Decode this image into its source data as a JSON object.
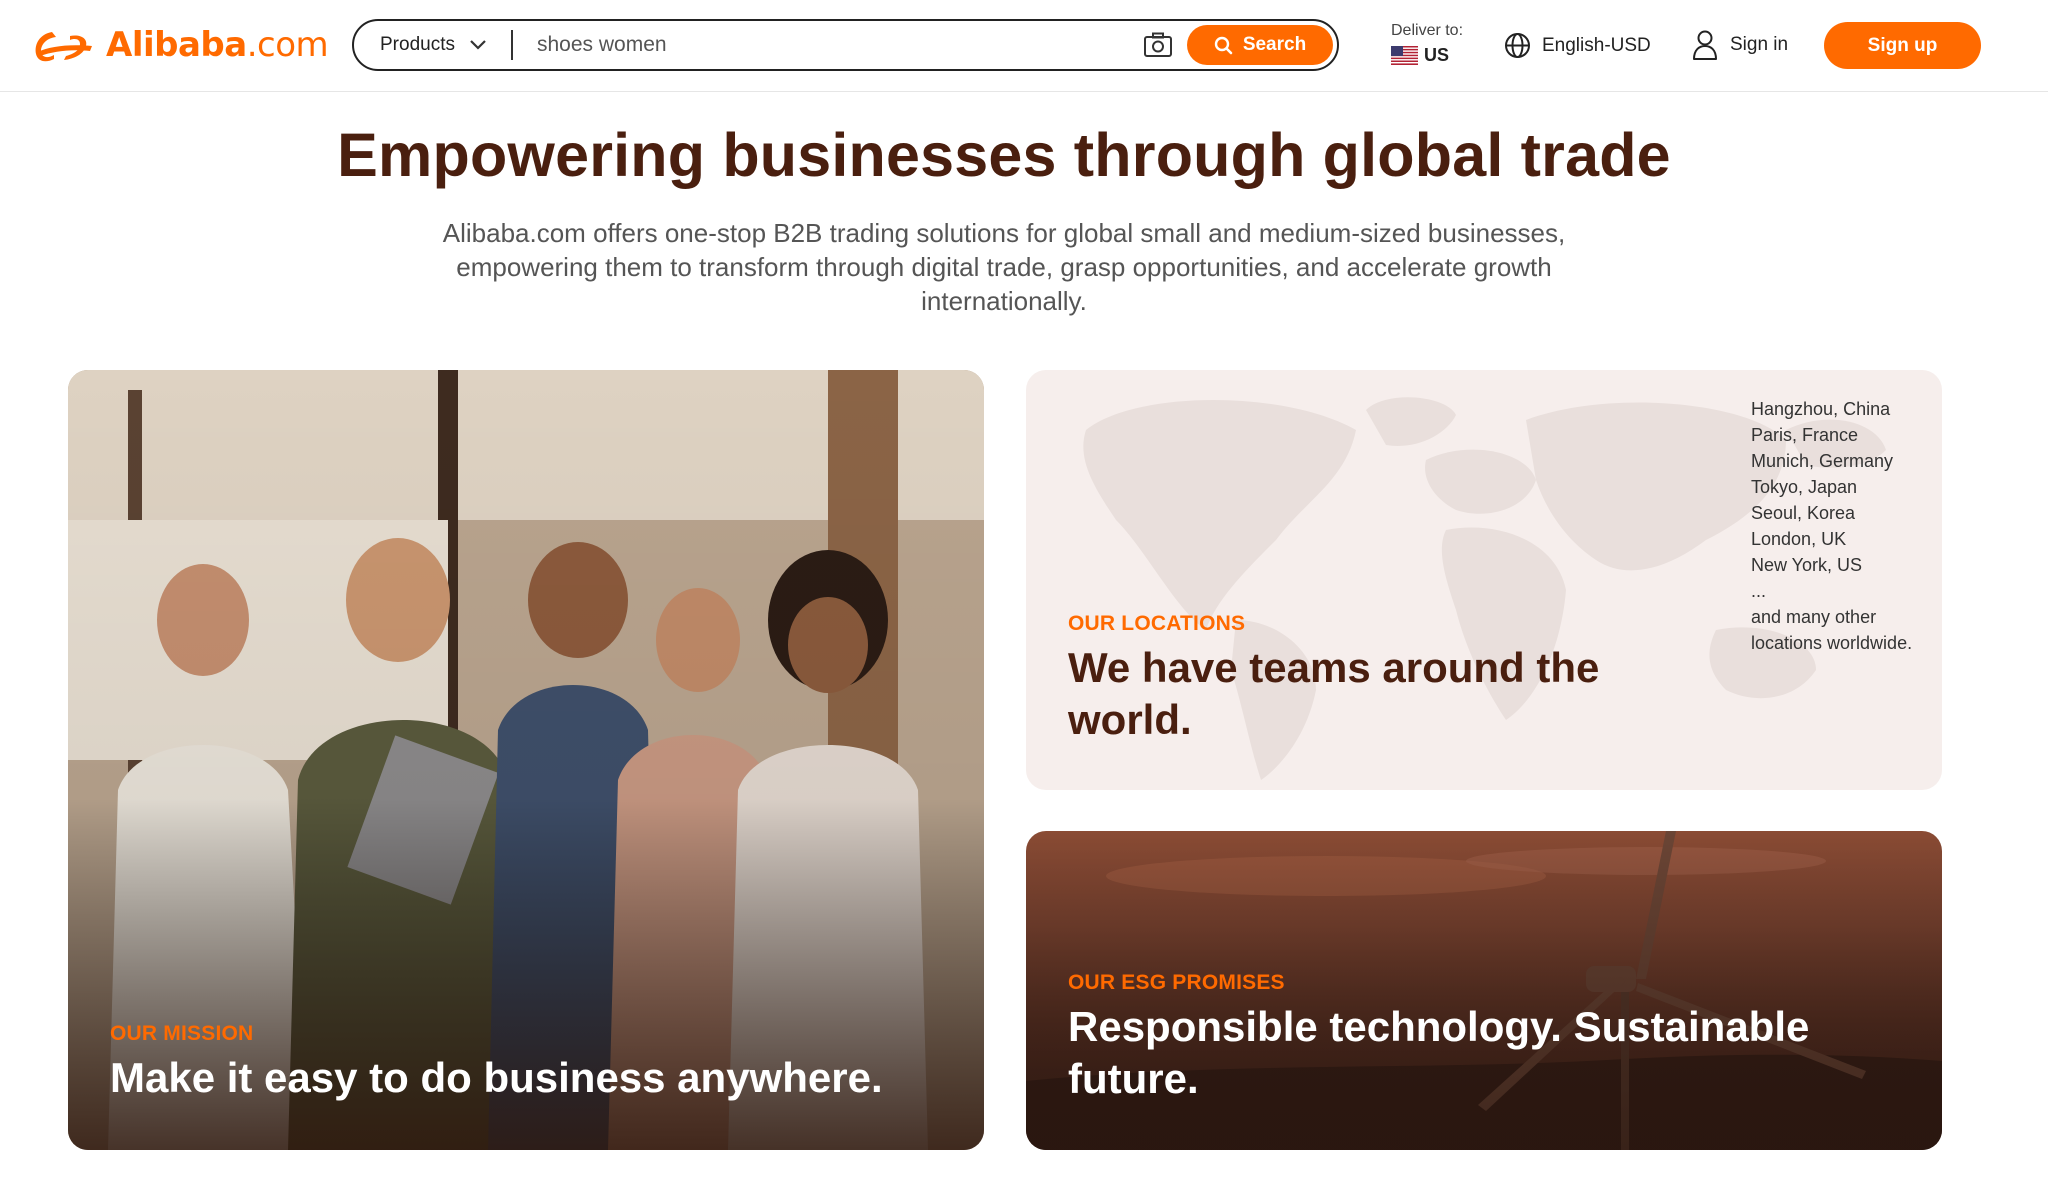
{
  "header": {
    "logo": {
      "brand": "Alibaba",
      "suffix": ".com"
    },
    "search": {
      "category_label": "Products",
      "value": "shoes women",
      "button_label": "Search"
    },
    "deliver": {
      "label": "Deliver to:",
      "country": "US"
    },
    "language": "English-USD",
    "signin_label": "Sign in",
    "signup_label": "Sign up",
    "colors": {
      "accent": "#ff6a00",
      "title": "#4a1f0f"
    }
  },
  "hero": {
    "title": "Empowering businesses through global trade",
    "subtitle": "Alibaba.com offers one-stop B2B trading solutions for global small and medium-sized businesses, empowering them to transform through digital trade, grasp opportunities, and accelerate growth internationally."
  },
  "cards": {
    "mission": {
      "eyebrow": "OUR MISSION",
      "heading": "Make it easy to do business anywhere."
    },
    "locations": {
      "eyebrow": "OUR LOCATIONS",
      "heading": "We have teams around the world.",
      "cities": [
        "Hangzhou, China",
        "Paris, France",
        "Munich, Germany",
        "Tokyo, Japan",
        "Seoul, Korea",
        "London, UK",
        "New York, US",
        "..."
      ],
      "more": "and many other locations worldwide."
    },
    "esg": {
      "eyebrow": "OUR ESG PROMISES",
      "heading": "Responsible technology. Sustainable future."
    }
  }
}
